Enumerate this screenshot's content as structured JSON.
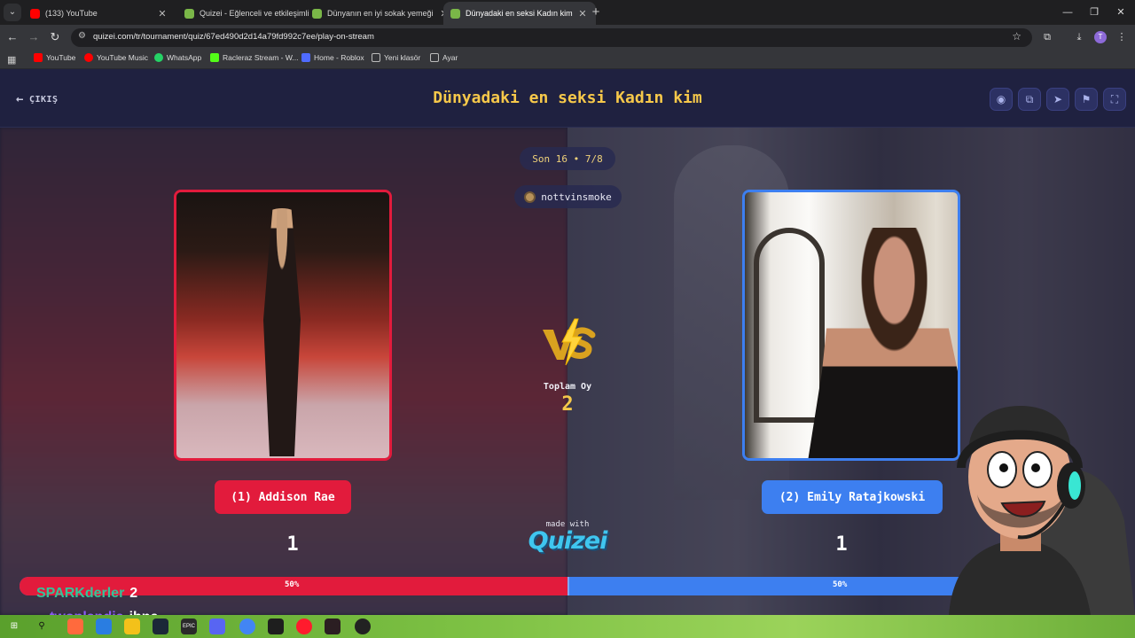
{
  "browser": {
    "tabs": [
      {
        "title": "(133) YouTube",
        "favicon_color": "#ff0000"
      },
      {
        "title": "Quizei - Eğlenceli ve etkileşimli",
        "favicon_color": "#7ab648"
      },
      {
        "title": "Dünyanın en iyi sokak yemeği",
        "favicon_color": "#7ab648"
      },
      {
        "title": "Dünyadaki en seksi Kadın kim",
        "favicon_color": "#7ab648"
      }
    ],
    "url": "quizei.com/tr/tournament/quiz/67ed490d2d14a79fd992c7ee/play-on-stream",
    "profile_initial": "T",
    "bookmarks": [
      {
        "label": "YouTube",
        "color": "#ff0000"
      },
      {
        "label": "YouTube Music",
        "color": "#ff0000"
      },
      {
        "label": "WhatsApp",
        "color": "#25d366"
      },
      {
        "label": "Racleraz Stream - W...",
        "color": "#53fc18"
      },
      {
        "label": "Home - Roblox",
        "color": "#4f6bff"
      },
      {
        "label": "Yeni klasör",
        "color": "#9a9a9a"
      },
      {
        "label": "Ayar",
        "color": "#9a9a9a"
      }
    ]
  },
  "header": {
    "exit_label": "ÇIKIŞ",
    "title": "Dünyadaki en seksi Kadın kim"
  },
  "round": {
    "label": "Son 16 • 7/8",
    "streamer": "nottvinsmoke"
  },
  "contestants": [
    {
      "label": "(1) Addison Rae",
      "votes": "1",
      "percent": "50%",
      "share": 0.5,
      "color": "#e21b3c"
    },
    {
      "label": "(2) Emily Ratajkowski",
      "votes": "1",
      "percent": "50%",
      "share": 0.5,
      "color": "#3d7ff0"
    }
  ],
  "total": {
    "label": "Toplam Oy",
    "value": "2"
  },
  "branding": {
    "made_with": "made with",
    "logo": "Quizei"
  },
  "chat": [
    {
      "user": "SPARKderler",
      "message": "2",
      "color": "#34c49a"
    },
    {
      "user": "twoplandia",
      "message": "ibne",
      "color": "#8b5cf6"
    }
  ],
  "colors": {
    "accent_yellow": "#f6c84a",
    "header_bg": "#1f2140",
    "red": "#e21b3c",
    "blue": "#3d7ff0"
  },
  "icons": {
    "header_buttons": [
      "eye-icon",
      "copy-icon",
      "send-icon",
      "flag-icon",
      "fullscreen-icon"
    ]
  }
}
